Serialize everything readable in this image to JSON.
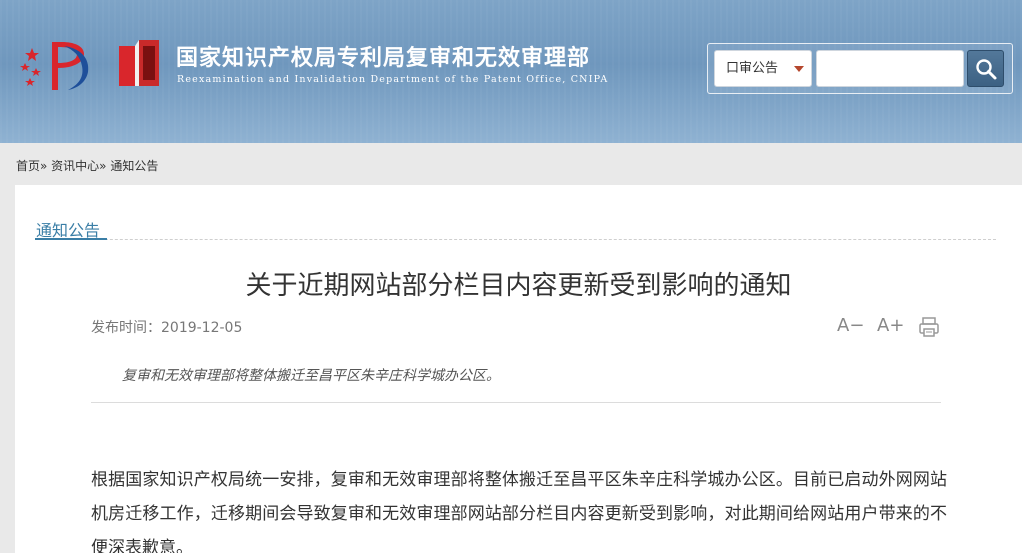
{
  "header": {
    "title_cn": "国家知识产权局专利局复审和无效审理部",
    "title_en": "Reexamination and Invalidation Department of the Patent Office, CNIPA",
    "logo_icon": "cnipa-logo-icon",
    "emblem_icon": "department-emblem-icon"
  },
  "search": {
    "selected_option": "口审公告",
    "input_value": "",
    "button_icon": "search-icon"
  },
  "breadcrumb": {
    "text": "首页» 资讯中心» 通知公告"
  },
  "section": {
    "title": "通知公告"
  },
  "article": {
    "title": "关于近期网站部分栏目内容更新受到影响的通知",
    "publish_time": "发布时间：2019-12-05",
    "font_decrease_label": "A−",
    "font_increase_label": "A+",
    "summary": "复审和无效审理部将整体搬迁至昌平区朱辛庄科学城办公区。",
    "body": "根据国家知识产权局统一安排，复审和无效审理部将整体搬迁至昌平区朱辛庄科学城办公区。目前已启动外网网站机房迁移工作，迁移期间会导致复审和无效审理部网站部分栏目内容更新受到影响，对此期间给网站用户带来的不便深表歉意。"
  },
  "colors": {
    "accent": "#3a7ea6",
    "header_bg": "#7ea4c7",
    "caret": "#b5472d"
  }
}
